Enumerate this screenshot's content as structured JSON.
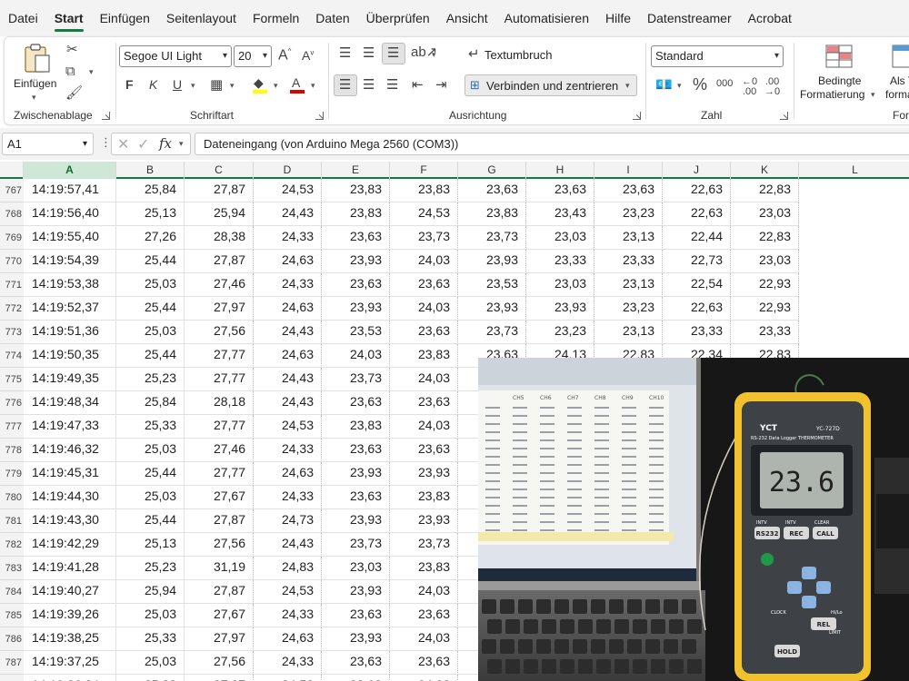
{
  "menu": [
    "Datei",
    "Start",
    "Einfügen",
    "Seitenlayout",
    "Formeln",
    "Daten",
    "Überprüfen",
    "Ansicht",
    "Automatisieren",
    "Hilfe",
    "Datenstreamer",
    "Acrobat"
  ],
  "ribbon": {
    "clipboard": {
      "paste_label": "Einfügen",
      "group_label": "Zwischenablage"
    },
    "font": {
      "family": "Segoe UI Light",
      "size": "20",
      "bold": "F",
      "italic": "K",
      "underline": "U",
      "group_label": "Schriftart"
    },
    "alignment": {
      "wrap_label": "Textumbruch",
      "merge_label": "Verbinden und zentrieren",
      "group_label": "Ausrichtung"
    },
    "number": {
      "format": "Standard",
      "group_label": "Zahl",
      "percent": "%",
      "thousands": "000"
    },
    "styles": {
      "conditional_line1": "Bedingte",
      "conditional_line2": "Formatierung",
      "next_line1": "Als T",
      "next_line2": "forma",
      "group_label": "For"
    }
  },
  "formula_bar": {
    "cell_ref": "A1",
    "fx": "fx",
    "content": "Dateneingang (von Arduino Mega 2560 (COM3))"
  },
  "columns": [
    "A",
    "B",
    "C",
    "D",
    "E",
    "F",
    "G",
    "H",
    "I",
    "J",
    "K",
    "L"
  ],
  "rows": [
    {
      "n": "767",
      "v": [
        "14:19:57,41",
        "25,84",
        "27,87",
        "24,53",
        "23,83",
        "23,83",
        "23,63",
        "23,63",
        "23,63",
        "22,63",
        "22,83"
      ]
    },
    {
      "n": "768",
      "v": [
        "14:19:56,40",
        "25,13",
        "25,94",
        "24,43",
        "23,83",
        "24,53",
        "23,83",
        "23,43",
        "23,23",
        "22,63",
        "23,03"
      ]
    },
    {
      "n": "769",
      "v": [
        "14:19:55,40",
        "27,26",
        "28,38",
        "24,33",
        "23,63",
        "23,73",
        "23,73",
        "23,03",
        "23,13",
        "22,44",
        "22,83"
      ]
    },
    {
      "n": "770",
      "v": [
        "14:19:54,39",
        "25,44",
        "27,87",
        "24,63",
        "23,93",
        "24,03",
        "23,93",
        "23,33",
        "23,33",
        "22,73",
        "23,03"
      ]
    },
    {
      "n": "771",
      "v": [
        "14:19:53,38",
        "25,03",
        "27,46",
        "24,33",
        "23,63",
        "23,63",
        "23,53",
        "23,03",
        "23,13",
        "22,54",
        "22,93"
      ]
    },
    {
      "n": "772",
      "v": [
        "14:19:52,37",
        "25,44",
        "27,97",
        "24,63",
        "23,93",
        "24,03",
        "23,93",
        "23,93",
        "23,23",
        "22,63",
        "22,93"
      ]
    },
    {
      "n": "773",
      "v": [
        "14:19:51,36",
        "25,03",
        "27,56",
        "24,43",
        "23,53",
        "23,63",
        "23,73",
        "23,23",
        "23,13",
        "23,33",
        "23,33"
      ]
    },
    {
      "n": "774",
      "v": [
        "14:19:50,35",
        "25,44",
        "27,77",
        "24,63",
        "24,03",
        "23,83",
        "23,63",
        "24,13",
        "22,83",
        "22,34",
        "22,83"
      ]
    },
    {
      "n": "775",
      "v": [
        "14:19:49,35",
        "25,23",
        "27,77",
        "24,43",
        "23,73",
        "24,03"
      ]
    },
    {
      "n": "776",
      "v": [
        "14:19:48,34",
        "25,84",
        "28,18",
        "24,43",
        "23,63",
        "23,63"
      ]
    },
    {
      "n": "777",
      "v": [
        "14:19:47,33",
        "25,33",
        "27,77",
        "24,53",
        "23,83",
        "24,03"
      ]
    },
    {
      "n": "778",
      "v": [
        "14:19:46,32",
        "25,03",
        "27,46",
        "24,33",
        "23,63",
        "23,63"
      ]
    },
    {
      "n": "779",
      "v": [
        "14:19:45,31",
        "25,44",
        "27,77",
        "24,63",
        "23,93",
        "23,93"
      ]
    },
    {
      "n": "780",
      "v": [
        "14:19:44,30",
        "25,03",
        "27,67",
        "24,33",
        "23,63",
        "23,83"
      ]
    },
    {
      "n": "781",
      "v": [
        "14:19:43,30",
        "25,44",
        "27,87",
        "24,73",
        "23,93",
        "23,93"
      ]
    },
    {
      "n": "782",
      "v": [
        "14:19:42,29",
        "25,13",
        "27,56",
        "24,43",
        "23,73",
        "23,73"
      ]
    },
    {
      "n": "783",
      "v": [
        "14:19:41,28",
        "25,23",
        "31,19",
        "24,83",
        "23,03",
        "23,83"
      ]
    },
    {
      "n": "784",
      "v": [
        "14:19:40,27",
        "25,94",
        "27,87",
        "24,53",
        "23,93",
        "24,03"
      ]
    },
    {
      "n": "785",
      "v": [
        "14:19:39,26",
        "25,03",
        "27,67",
        "24,33",
        "23,63",
        "23,63"
      ]
    },
    {
      "n": "786",
      "v": [
        "14:19:38,25",
        "25,33",
        "27,97",
        "24,63",
        "23,93",
        "24,03"
      ]
    },
    {
      "n": "787",
      "v": [
        "14:19:37,25",
        "25,03",
        "27,56",
        "24,33",
        "23,63",
        "23,63"
      ]
    },
    {
      "n": "788",
      "v": [
        "14:19:36,24",
        "25,33",
        "27,87",
        "24,53",
        "23,93",
        "24,03"
      ]
    }
  ],
  "photo": {
    "thermometer_brand": "YCT",
    "thermometer_model": "YC-727D",
    "thermometer_title": "RS-232 Data Logger THERMOMETER",
    "display_value": "23.6",
    "keys": [
      "RS232",
      "REC",
      "CALL",
      "HOLD",
      "REL"
    ],
    "labels": [
      "INTV",
      "INTV",
      "CLEAR",
      "CLOCK",
      "Hi/Lo",
      "LIMIT"
    ],
    "screen_headers": [
      "CH5",
      "CH6",
      "CH7",
      "CH8",
      "CH9",
      "CH10"
    ]
  },
  "colors": {
    "accent": "#107c41",
    "selected_header": "#cfe7d7",
    "ribbon_bg": "#f3f3f3"
  }
}
